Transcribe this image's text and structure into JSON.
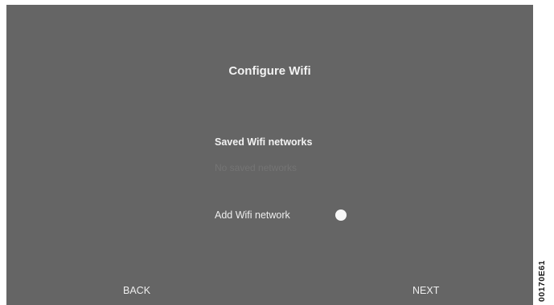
{
  "screen": {
    "title": "Configure Wifi",
    "saved_section": {
      "heading": "Saved Wifi networks",
      "empty_text": "No saved networks"
    },
    "add_network": {
      "label": "Add Wifi network",
      "toggle_state": "off"
    },
    "nav": {
      "back_label": "BACK",
      "next_label": "NEXT"
    }
  },
  "figure_code": "00170E61",
  "colors": {
    "screen_background": "#656565",
    "text_primary": "#f2f2f2",
    "text_disabled": "#747474",
    "toggle_knob": "#f7f7f7"
  }
}
